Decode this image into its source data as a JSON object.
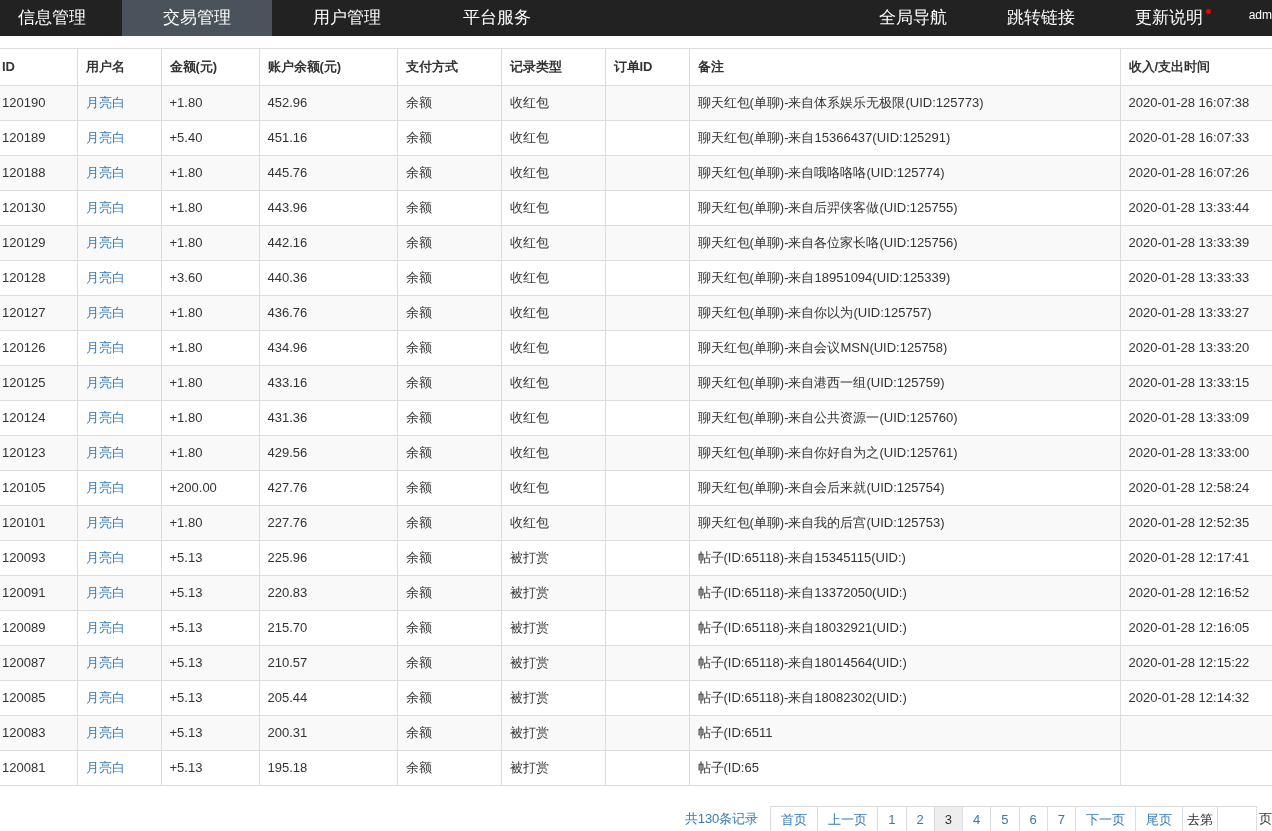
{
  "nav": {
    "left": [
      {
        "label": "信息管理",
        "selected": false
      },
      {
        "label": "交易管理",
        "selected": true
      },
      {
        "label": "用户管理",
        "selected": false
      },
      {
        "label": "平台服务",
        "selected": false
      }
    ],
    "right": [
      {
        "label": "全局导航",
        "dot": false
      },
      {
        "label": "跳转链接",
        "dot": false
      },
      {
        "label": "更新说明",
        "dot": true
      }
    ],
    "user": "adm"
  },
  "table": {
    "columns": [
      "ID",
      "用户名",
      "金额(元)",
      "账户余额(元)",
      "支付方式",
      "记录类型",
      "订单ID",
      "备注",
      "收入/支出时间"
    ],
    "rows": [
      {
        "id": "120190",
        "user": "月亮白",
        "amount": "+1.80",
        "balance": "452.96",
        "pay": "余额",
        "type": "收红包",
        "remark": "聊天红包(单聊)-来自体系娱乐无极限(UID:125773)",
        "time": "2020-01-28 16:07:38"
      },
      {
        "id": "120189",
        "user": "月亮白",
        "amount": "+5.40",
        "balance": "451.16",
        "pay": "余额",
        "type": "收红包",
        "remark": "聊天红包(单聊)-来自15366437(UID:125291)",
        "time": "2020-01-28 16:07:33"
      },
      {
        "id": "120188",
        "user": "月亮白",
        "amount": "+1.80",
        "balance": "445.76",
        "pay": "余额",
        "type": "收红包",
        "remark": "聊天红包(单聊)-来自哦咯咯咯(UID:125774)",
        "time": "2020-01-28 16:07:26"
      },
      {
        "id": "120130",
        "user": "月亮白",
        "amount": "+1.80",
        "balance": "443.96",
        "pay": "余额",
        "type": "收红包",
        "remark": "聊天红包(单聊)-来自后羿侠客做(UID:125755)",
        "time": "2020-01-28 13:33:44"
      },
      {
        "id": "120129",
        "user": "月亮白",
        "amount": "+1.80",
        "balance": "442.16",
        "pay": "余额",
        "type": "收红包",
        "remark": "聊天红包(单聊)-来自各位家长咯(UID:125756)",
        "time": "2020-01-28 13:33:39"
      },
      {
        "id": "120128",
        "user": "月亮白",
        "amount": "+3.60",
        "balance": "440.36",
        "pay": "余额",
        "type": "收红包",
        "remark": "聊天红包(单聊)-来自18951094(UID:125339)",
        "time": "2020-01-28 13:33:33"
      },
      {
        "id": "120127",
        "user": "月亮白",
        "amount": "+1.80",
        "balance": "436.76",
        "pay": "余额",
        "type": "收红包",
        "remark": "聊天红包(单聊)-来自你以为(UID:125757)",
        "time": "2020-01-28 13:33:27"
      },
      {
        "id": "120126",
        "user": "月亮白",
        "amount": "+1.80",
        "balance": "434.96",
        "pay": "余额",
        "type": "收红包",
        "remark": "聊天红包(单聊)-来自会议MSN(UID:125758)",
        "time": "2020-01-28 13:33:20"
      },
      {
        "id": "120125",
        "user": "月亮白",
        "amount": "+1.80",
        "balance": "433.16",
        "pay": "余额",
        "type": "收红包",
        "remark": "聊天红包(单聊)-来自港西一组(UID:125759)",
        "time": "2020-01-28 13:33:15"
      },
      {
        "id": "120124",
        "user": "月亮白",
        "amount": "+1.80",
        "balance": "431.36",
        "pay": "余额",
        "type": "收红包",
        "remark": "聊天红包(单聊)-来自公共资源一(UID:125760)",
        "time": "2020-01-28 13:33:09"
      },
      {
        "id": "120123",
        "user": "月亮白",
        "amount": "+1.80",
        "balance": "429.56",
        "pay": "余额",
        "type": "收红包",
        "remark": "聊天红包(单聊)-来自你好自为之(UID:125761)",
        "time": "2020-01-28 13:33:00"
      },
      {
        "id": "120105",
        "user": "月亮白",
        "amount": "+200.00",
        "balance": "427.76",
        "pay": "余额",
        "type": "收红包",
        "remark": "聊天红包(单聊)-来自会后来就(UID:125754)",
        "time": "2020-01-28 12:58:24"
      },
      {
        "id": "120101",
        "user": "月亮白",
        "amount": "+1.80",
        "balance": "227.76",
        "pay": "余额",
        "type": "收红包",
        "remark": "聊天红包(单聊)-来自我的后宫(UID:125753)",
        "time": "2020-01-28 12:52:35"
      },
      {
        "id": "120093",
        "user": "月亮白",
        "amount": "+5.13",
        "balance": "225.96",
        "pay": "余额",
        "type": "被打赏",
        "remark": "帖子(ID:65118)-来自15345115(UID:)",
        "time": "2020-01-28 12:17:41"
      },
      {
        "id": "120091",
        "user": "月亮白",
        "amount": "+5.13",
        "balance": "220.83",
        "pay": "余额",
        "type": "被打赏",
        "remark": "帖子(ID:65118)-来自13372050(UID:)",
        "time": "2020-01-28 12:16:52"
      },
      {
        "id": "120089",
        "user": "月亮白",
        "amount": "+5.13",
        "balance": "215.70",
        "pay": "余额",
        "type": "被打赏",
        "remark": "帖子(ID:65118)-来自18032921(UID:)",
        "time": "2020-01-28 12:16:05"
      },
      {
        "id": "120087",
        "user": "月亮白",
        "amount": "+5.13",
        "balance": "210.57",
        "pay": "余额",
        "type": "被打赏",
        "remark": "帖子(ID:65118)-来自18014564(UID:)",
        "time": "2020-01-28 12:15:22"
      },
      {
        "id": "120085",
        "user": "月亮白",
        "amount": "+5.13",
        "balance": "205.44",
        "pay": "余额",
        "type": "被打赏",
        "remark": "帖子(ID:65118)-来自18082302(UID:)",
        "time": "2020-01-28 12:14:32"
      },
      {
        "id": "120083",
        "user": "月亮白",
        "amount": "+5.13",
        "balance": "200.31",
        "pay": "余额",
        "type": "被打赏",
        "remark": "帖子(ID:6511"
      },
      {
        "id": "120081",
        "user": "月亮白",
        "amount": "+5.13",
        "balance": "195.18",
        "pay": "余额",
        "type": "被打赏",
        "remark": "帖子(ID:65"
      }
    ]
  },
  "pagination": {
    "total": "共130条记录",
    "pages": [
      {
        "label": "首页",
        "selected": false
      },
      {
        "label": "上一页",
        "selected": false
      },
      {
        "label": "1",
        "selected": false
      },
      {
        "label": "2",
        "selected": false
      },
      {
        "label": "3",
        "selected": true
      },
      {
        "label": "4",
        "selected": false
      },
      {
        "label": "5",
        "selected": false
      },
      {
        "label": "6",
        "selected": false
      },
      {
        "label": "7",
        "selected": false
      },
      {
        "label": "下一页",
        "selected": false
      },
      {
        "label": "尾页",
        "selected": false
      }
    ],
    "goto": "去第",
    "goto_suffix": "页"
  }
}
